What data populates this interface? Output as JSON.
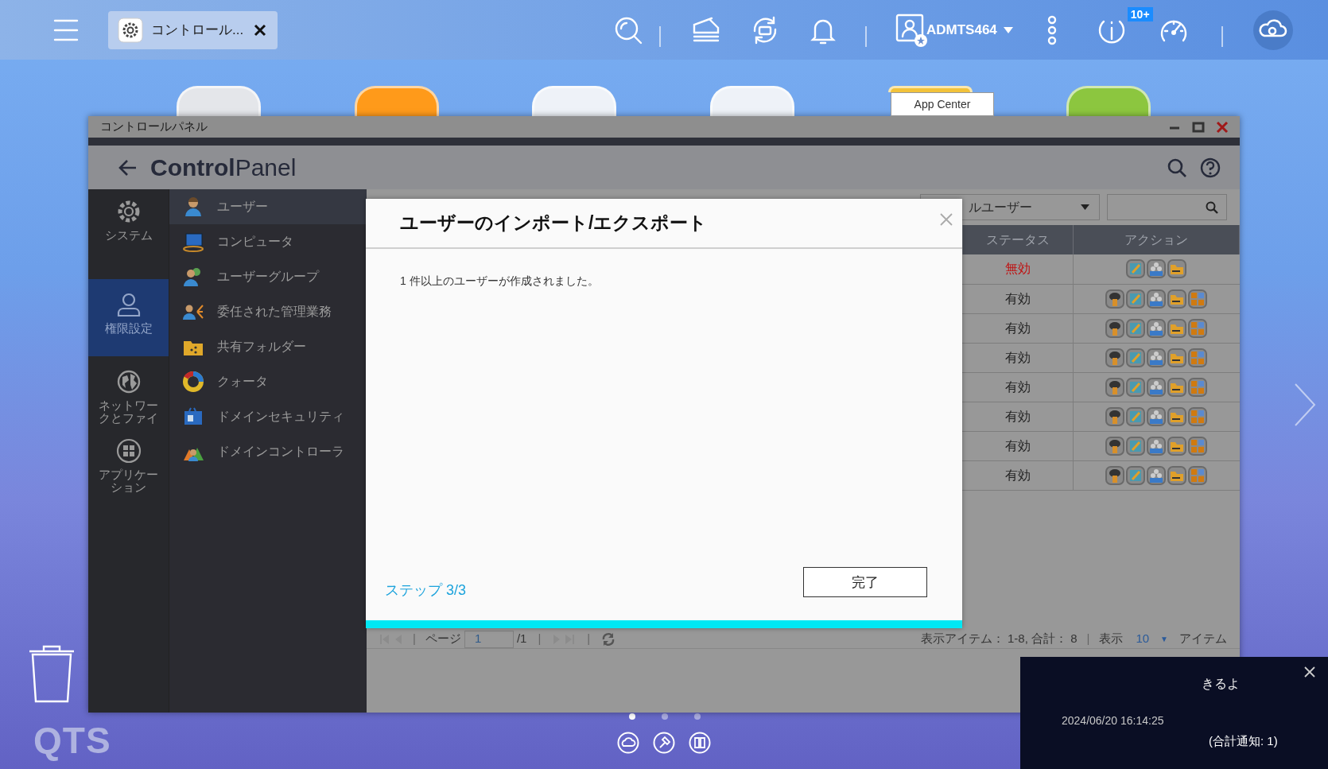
{
  "taskbar": {
    "tabs": [
      {
        "label": "コントロール...",
        "selected": true
      }
    ],
    "username": "ADMTS464",
    "badge": "10+"
  },
  "desktop_apps": [
    {
      "color": "#e4e6ea"
    },
    {
      "color": "#ff9a1a"
    },
    {
      "color": "#eef2f8"
    },
    {
      "color": "#eef2f8"
    },
    {
      "color": "#f2c23a",
      "tooltip": "App Center"
    },
    {
      "color": "#8cc63f"
    }
  ],
  "window": {
    "title": "コントロールパネル",
    "app_title": "**Control**Panel"
  },
  "categories": [
    {
      "label": "システム",
      "kind": "gear",
      "selected": false
    },
    {
      "label": "権限設定",
      "kind": "person",
      "selected": true
    },
    {
      "label": "ネットワークとファイ",
      "kind": "globe",
      "selected": false
    },
    {
      "label": "アプリケーション",
      "kind": "apps",
      "selected": false
    }
  ],
  "menu": [
    {
      "label": "ユーザー",
      "kind": "user",
      "selected": true
    },
    {
      "label": "コンピュータ",
      "kind": "computer",
      "selected": false
    },
    {
      "label": "ユーザーグループ",
      "kind": "group",
      "selected": false
    },
    {
      "label": "委任された管理業務",
      "kind": "delegate",
      "selected": false
    },
    {
      "label": "共有フォルダー",
      "kind": "share",
      "selected": false
    },
    {
      "label": "クォータ",
      "kind": "quota",
      "selected": false
    },
    {
      "label": "ドメインセキュリティ",
      "kind": "security",
      "selected": false
    },
    {
      "label": "ドメインコントローラ",
      "kind": "controller",
      "selected": false
    }
  ],
  "filter": {
    "value": "ルユーザー"
  },
  "table": {
    "columns": [
      "ステータス",
      "アクション"
    ],
    "rows": [
      {
        "status": "無効",
        "enabled": false,
        "actions": [
          {
            "kind": "edit"
          },
          {
            "kind": "group"
          },
          {
            "kind": "folder"
          }
        ]
      },
      {
        "status": "有効",
        "enabled": true,
        "actions": [
          {
            "kind": "key"
          },
          {
            "kind": "edit"
          },
          {
            "kind": "group"
          },
          {
            "kind": "folder"
          },
          {
            "kind": "apps"
          }
        ]
      },
      {
        "status": "有効",
        "enabled": true,
        "actions": [
          {
            "kind": "key"
          },
          {
            "kind": "edit"
          },
          {
            "kind": "group"
          },
          {
            "kind": "folder"
          },
          {
            "kind": "apps"
          }
        ]
      },
      {
        "status": "有効",
        "enabled": true,
        "actions": [
          {
            "kind": "key"
          },
          {
            "kind": "edit"
          },
          {
            "kind": "group"
          },
          {
            "kind": "folder"
          },
          {
            "kind": "apps"
          }
        ]
      },
      {
        "status": "有効",
        "enabled": true,
        "actions": [
          {
            "kind": "key"
          },
          {
            "kind": "edit"
          },
          {
            "kind": "group"
          },
          {
            "kind": "folder"
          },
          {
            "kind": "apps"
          }
        ]
      },
      {
        "status": "有効",
        "enabled": true,
        "actions": [
          {
            "kind": "key"
          },
          {
            "kind": "edit"
          },
          {
            "kind": "group"
          },
          {
            "kind": "folder"
          },
          {
            "kind": "apps"
          }
        ]
      },
      {
        "status": "有効",
        "enabled": true,
        "actions": [
          {
            "kind": "key"
          },
          {
            "kind": "edit"
          },
          {
            "kind": "group"
          },
          {
            "kind": "folder"
          },
          {
            "kind": "apps"
          }
        ]
      },
      {
        "status": "有効",
        "enabled": true,
        "actions": [
          {
            "kind": "key"
          },
          {
            "kind": "edit"
          },
          {
            "kind": "group"
          },
          {
            "kind": "folder"
          },
          {
            "kind": "apps"
          }
        ]
      }
    ]
  },
  "pagination": {
    "page_label": "ページ",
    "page": "1",
    "total_pages": "/1",
    "summary": "表示アイテム： 1-8, 合計： 8",
    "separator": "|",
    "show_label": "表示",
    "per_page": "10",
    "caret": "▼",
    "items_label": "アイテム"
  },
  "dialog": {
    "title": "ユーザーのインポート/エクスポート",
    "message": "1 件以上のユーザーが作成されました。",
    "step": "ステップ 3/3",
    "button": "完了",
    "level": 1
  },
  "notification": {
    "text": "きるよ",
    "time": "2024/06/20 16:14:25",
    "total": "(合計通知: 1)"
  },
  "pager_dots": [
    {
      "selected": true
    },
    {
      "selected": false
    },
    {
      "selected": false
    }
  ],
  "logo": "QTS"
}
